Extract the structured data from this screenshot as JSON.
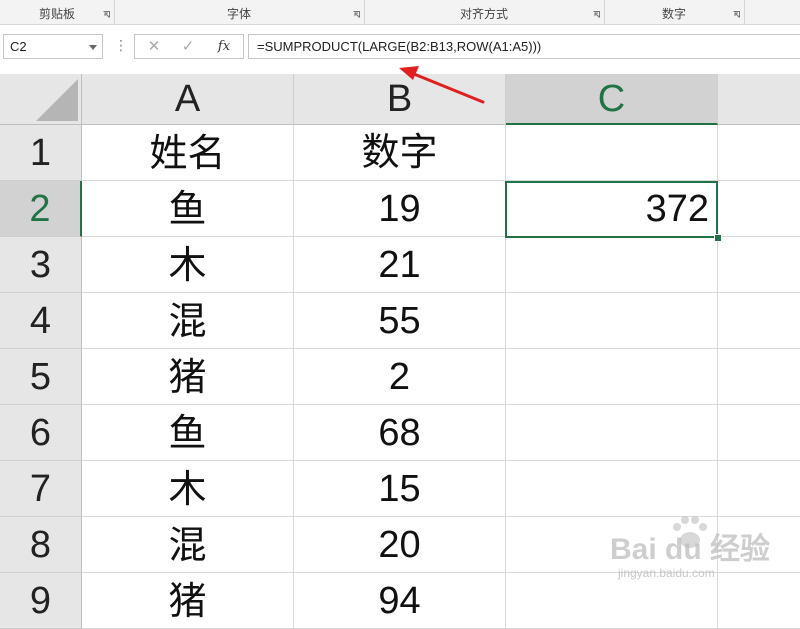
{
  "ribbon": {
    "groups": [
      {
        "label": "剪贴板"
      },
      {
        "label": "字体"
      },
      {
        "label": "对齐方式"
      },
      {
        "label": "数字"
      }
    ]
  },
  "formula_bar": {
    "name_box": "C2",
    "cancel_glyph": "✕",
    "enter_glyph": "✓",
    "fx_glyph": "fx",
    "formula": "=SUMPRODUCT(LARGE(B2:B13,ROW(A1:A5)))"
  },
  "columns": [
    {
      "label": "A"
    },
    {
      "label": "B"
    },
    {
      "label": "C",
      "selected": true
    }
  ],
  "rows": [
    {
      "num": "1",
      "a": "姓名",
      "b": "数字",
      "c": ""
    },
    {
      "num": "2",
      "a": "鱼",
      "b": "19",
      "c": "372",
      "selected": true
    },
    {
      "num": "3",
      "a": "木",
      "b": "21",
      "c": ""
    },
    {
      "num": "4",
      "a": "混",
      "b": "55",
      "c": ""
    },
    {
      "num": "5",
      "a": "猪",
      "b": "2",
      "c": ""
    },
    {
      "num": "6",
      "a": "鱼",
      "b": "68",
      "c": ""
    },
    {
      "num": "7",
      "a": "木",
      "b": "15",
      "c": ""
    },
    {
      "num": "8",
      "a": "混",
      "b": "20",
      "c": ""
    },
    {
      "num": "9",
      "a": "猪",
      "b": "94",
      "c": ""
    }
  ],
  "colors": {
    "accent": "#217346",
    "annotation_arrow": "#e02020"
  },
  "watermark": {
    "brand": "Bai du 经验",
    "sub": "jingyan.baidu.com"
  }
}
